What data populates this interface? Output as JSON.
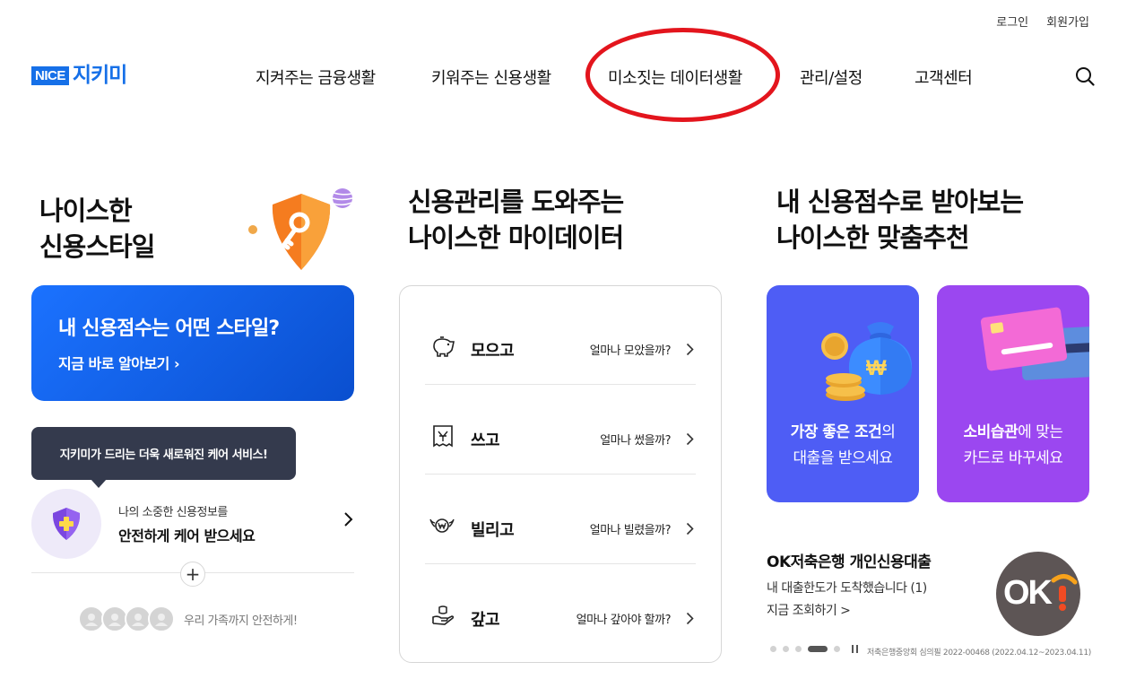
{
  "util": {
    "login": "로그인",
    "signup": "회원가입"
  },
  "logo": {
    "brand": "NICE",
    "name": "지키미"
  },
  "nav": [
    {
      "label": "지켜주는 금융생활"
    },
    {
      "label": "키워주는 신용생활"
    },
    {
      "label": "미소짓는 데이터생활",
      "highlighted": true
    },
    {
      "label": "관리/설정"
    },
    {
      "label": "고객센터"
    }
  ],
  "colors": {
    "accent": "#1670e8",
    "highlight_oval": "#e3151d",
    "tooltip_bg": "#343a4d",
    "card_blue": "#4e5df5",
    "card_purple": "#9b47f0"
  },
  "style": {
    "title_line1": "나이스한",
    "title_line2": "신용스타일",
    "card_title": "내 신용점수는 어떤 스타일?",
    "card_link": "지금 바로 알아보기 ›",
    "tooltip": "지키미가 드리는 더욱 새로워진 케어 서비스!",
    "care_sub": "나의 소중한 신용정보를",
    "care_main": "안전하게 케어 받으세요",
    "family_text": "우리 가족까지 안전하게!"
  },
  "mydata": {
    "title_line1": "신용관리를 도와주는",
    "title_line2": "나이스한 마이데이터",
    "items": [
      {
        "icon": "piggy-bank-icon",
        "label": "모으고",
        "question": "얼마나 모았을까?"
      },
      {
        "icon": "receipt-icon",
        "label": "쓰고",
        "question": "얼마나 썼을까?"
      },
      {
        "icon": "winged-coin-icon",
        "label": "빌리고",
        "question": "얼마나 빌렸을까?"
      },
      {
        "icon": "hand-coin-icon",
        "label": "갚고",
        "question": "얼마나 갚아야 할까?"
      }
    ]
  },
  "recommend": {
    "title_line1": "내 신용점수로 받아보는",
    "title_line2": "나이스한 맞춤추천",
    "cards": [
      {
        "bold": "가장 좋은 조건",
        "rest1": "의",
        "line2": "대출을 받으세요"
      },
      {
        "bold": "소비습관",
        "rest1": "에 맞는",
        "line2": "카드로 바꾸세요"
      }
    ],
    "ad": {
      "title": "OK저축은행 개인신용대출",
      "sub": "내 대출한도가 도착했습니다 (1)",
      "link": "지금 조회하기 >",
      "logo_text": "OK",
      "disclaimer": "저축은행중앙회 심의필 2022-00468 (2022.04.12~2023.04.11)"
    },
    "pager": {
      "total": 5,
      "active": 4
    }
  }
}
